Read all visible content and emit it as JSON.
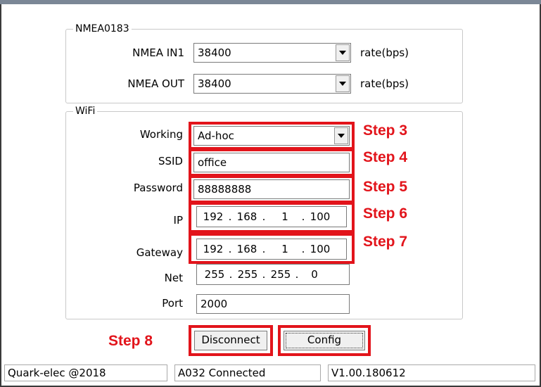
{
  "nmea": {
    "title": "NMEA0183",
    "in_label": "NMEA IN1",
    "in_value": "38400",
    "out_label": "NMEA OUT",
    "out_value": "38400",
    "rate_in": "rate(bps)",
    "rate_out": "rate(bps)"
  },
  "wifi": {
    "title": "WiFi",
    "working_label": "Working",
    "working_value": "Ad-hoc",
    "ssid_label": "SSID",
    "ssid_value": "office",
    "password_label": "Password",
    "password_value": "88888888",
    "ip_label": "IP",
    "ip": [
      "192",
      "168",
      "1",
      "100"
    ],
    "gateway_label": "Gateway",
    "gateway": [
      "192",
      "168",
      "1",
      "100"
    ],
    "net_label": "Net",
    "net": [
      "255",
      "255",
      "255",
      "0"
    ],
    "port_label": "Port",
    "port_value": "2000",
    "dot": "."
  },
  "steps": {
    "s3": "Step 3",
    "s4": "Step 4",
    "s5": "Step 5",
    "s6": "Step 6",
    "s7": "Step 7",
    "s8": "Step 8"
  },
  "buttons": {
    "disconnect": "Disconnect",
    "config": "Config"
  },
  "status": {
    "copyright": "Quark-elec @2018",
    "connection": "A032 Connected",
    "version": "V1.00.180612"
  },
  "colors": {
    "annotation_red": "#e2141b",
    "frame": "#3a3a3a"
  }
}
